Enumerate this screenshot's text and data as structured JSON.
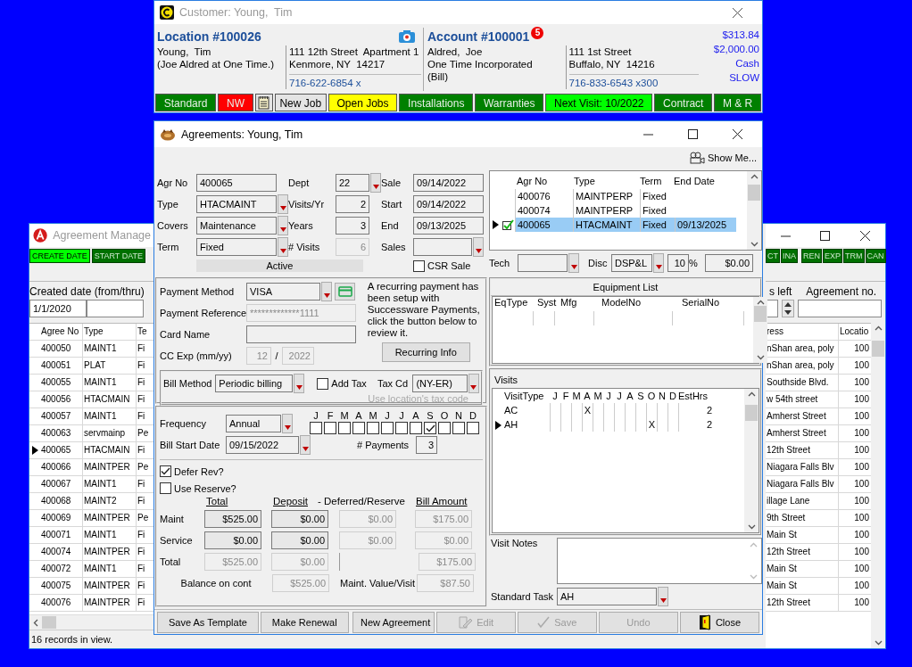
{
  "customer": {
    "title": "Customer: Young,  Tim",
    "location": {
      "heading": "Location #100026",
      "lines": [
        "Young,  Tim",
        "(Joe Aldred at One Time.)"
      ],
      "address": [
        "111 12th Street  Apartment 1",
        "Kenmore, NY  14217"
      ],
      "phone": "716-622-6854 x"
    },
    "account": {
      "heading": "Account #100001",
      "badge": "5",
      "lines": [
        "Aldred,  Joe",
        "One Time Incorporated",
        "(Bill)"
      ],
      "address": [
        "111 1st Street",
        "Buffalo, NY  14216"
      ],
      "phone": "716-833-6543 x300"
    },
    "balances": [
      "$313.84",
      "$2,000.00",
      "Cash",
      "SLOW"
    ],
    "tabs": [
      {
        "label": "Standard",
        "kind": "status",
        "color": "#008000"
      },
      {
        "label": "NW",
        "kind": "status",
        "color": "#ff0000"
      },
      {
        "label": "New Job",
        "kind": "button"
      },
      {
        "label": "Open Jobs",
        "kind": "status",
        "color": "#ffff00"
      },
      {
        "label": "Installations",
        "kind": "status",
        "color": "#008000"
      },
      {
        "label": "Warranties",
        "kind": "status",
        "color": "#008000"
      },
      {
        "label": "Next Visit: 10/2022",
        "kind": "status",
        "color": "#00ff00"
      },
      {
        "label": "Contract",
        "kind": "status",
        "color": "#008000"
      },
      {
        "label": "M & R",
        "kind": "status",
        "color": "#008000"
      }
    ]
  },
  "manager": {
    "title": "Agreement Manage",
    "filters_left": [
      {
        "label": "CREATE DATE",
        "selected": true
      },
      {
        "label": "START DATE",
        "selected": false
      }
    ],
    "filters_right": [
      {
        "label": "CT",
        "selected": false
      },
      {
        "label": "INA",
        "selected": false
      },
      {
        "label": "REN",
        "selected": false
      },
      {
        "label": "EXP",
        "selected": false
      },
      {
        "label": "TRM",
        "selected": false
      },
      {
        "label": "CAN",
        "selected": false
      }
    ],
    "date_label": "Created date (from/thru)",
    "date_from": "1/1/2020",
    "left_label": "s left",
    "agreement_no_label": "Agreement no.",
    "columns_left": [
      "Agree No",
      "Type",
      "Te"
    ],
    "columns_right": [
      "ress",
      "Locatio"
    ],
    "rows": [
      {
        "agree_no": "400050",
        "type": "MAINT1",
        "term": "Fi",
        "address": "nShan area, poly",
        "location": "100",
        "selected": false
      },
      {
        "agree_no": "400051",
        "type": "PLAT",
        "term": "Fi",
        "address": "nShan area, poly",
        "location": "100",
        "selected": false
      },
      {
        "agree_no": "400055",
        "type": "MAINT1",
        "term": "Fi",
        "address": "Southside Blvd.",
        "location": "100",
        "selected": false
      },
      {
        "agree_no": "400056",
        "type": "HTACMAIN",
        "term": "Fi",
        "address": "w 54th street",
        "location": "100",
        "selected": false
      },
      {
        "agree_no": "400057",
        "type": "MAINT1",
        "term": "Fi",
        "address": "Amherst Street",
        "location": "100",
        "selected": false
      },
      {
        "agree_no": "400063",
        "type": "servmainp",
        "term": "Pe",
        "address": "Amherst Street",
        "location": "100",
        "selected": false
      },
      {
        "agree_no": "400065",
        "type": "HTACMAIN",
        "term": "Fi",
        "address": "12th Street",
        "location": "100",
        "selected": true
      },
      {
        "agree_no": "400066",
        "type": "MAINTPER",
        "term": "Pe",
        "address": "Niagara Falls Blv",
        "location": "100",
        "selected": false
      },
      {
        "agree_no": "400067",
        "type": "MAINT1",
        "term": "Fi",
        "address": "Niagara Falls Blv",
        "location": "100",
        "selected": false
      },
      {
        "agree_no": "400068",
        "type": "MAINT2",
        "term": "Fi",
        "address": "illage Lane",
        "location": "100",
        "selected": false
      },
      {
        "agree_no": "400069",
        "type": "MAINTPER",
        "term": "Pe",
        "address": "9th Street",
        "location": "100",
        "selected": false
      },
      {
        "agree_no": "400071",
        "type": "MAINT1",
        "term": "Fi",
        "address": "Main St",
        "location": "100",
        "selected": false
      },
      {
        "agree_no": "400074",
        "type": "MAINTPER",
        "term": "Fi",
        "address": "12th Street",
        "location": "100",
        "selected": false
      },
      {
        "agree_no": "400072",
        "type": "MAINT1",
        "term": "Fi",
        "address": "Main St",
        "location": "100",
        "selected": false
      },
      {
        "agree_no": "400075",
        "type": "MAINTPER",
        "term": "Fi",
        "address": "Main St",
        "location": "100",
        "selected": false
      },
      {
        "agree_no": "400076",
        "type": "MAINTPER",
        "term": "Fi",
        "address": "12th Street",
        "location": "100",
        "selected": false
      }
    ],
    "status": "16 records in view."
  },
  "agreements": {
    "title": "Agreements: Young, Tim",
    "show_me": "Show Me...",
    "header_rows": [
      [
        {
          "label": "Agr No",
          "value": "400065",
          "kind": "text",
          "disabled": false
        },
        {
          "label": "Dept",
          "value": "22",
          "kind": "dropdown",
          "disabled": false
        },
        {
          "label": "Sale",
          "value": "09/14/2022",
          "kind": "text",
          "disabled": false
        }
      ],
      [
        {
          "label": "Type",
          "value": "HTACMAINT",
          "kind": "dropdown",
          "disabled": false
        },
        {
          "label": "Visits/Yr",
          "value": "2",
          "kind": "number",
          "disabled": false
        },
        {
          "label": "Start",
          "value": "09/14/2022",
          "kind": "text",
          "disabled": false
        }
      ],
      [
        {
          "label": "Covers",
          "value": "Maintenance",
          "kind": "dropdown",
          "disabled": false
        },
        {
          "label": "Years",
          "value": "3",
          "kind": "number",
          "disabled": false
        },
        {
          "label": "End",
          "value": "09/13/2025",
          "kind": "text",
          "disabled": false
        }
      ],
      [
        {
          "label": "Term",
          "value": "Fixed",
          "kind": "dropdown",
          "disabled": false
        },
        {
          "label": "# Visits",
          "value": "6",
          "kind": "number",
          "disabled": true
        },
        {
          "label": "Sales",
          "kind": "dropdown",
          "disabled": false
        }
      ]
    ],
    "status_text": "Active",
    "csr_sale": {
      "label": "CSR Sale",
      "checked": false
    },
    "payment": {
      "method_label": "Payment Method",
      "method": "VISA",
      "reference_label": "Payment Reference",
      "reference": "*************1111",
      "card_name_label": "Card Name",
      "exp_label": "CC Exp (mm/yy)",
      "exp_month": "12",
      "exp_sep": "/",
      "exp_year": "2022",
      "note": "A recurring payment has been setup with Successware Payments, click the button below to review it.",
      "recurring_button": "Recurring Info"
    },
    "billing": {
      "method_label": "Bill Method",
      "method": "Periodic billing",
      "add_tax": {
        "label": "Add Tax",
        "checked": false
      },
      "tax_label": "Tax Cd",
      "tax_code": "(NY-ER)",
      "tax_hint": "Use location's tax code"
    },
    "schedule": {
      "frequency_label": "Frequency",
      "frequency": "Annual",
      "bill_start_label": "Bill Start Date",
      "bill_start": "09/15/2022",
      "payments_label": "# Payments",
      "payments": "3",
      "months": [
        {
          "label": "J",
          "checked": false
        },
        {
          "label": "F",
          "checked": false
        },
        {
          "label": "M",
          "checked": false
        },
        {
          "label": "A",
          "checked": false
        },
        {
          "label": "M",
          "checked": false
        },
        {
          "label": "J",
          "checked": false
        },
        {
          "label": "J",
          "checked": false
        },
        {
          "label": "A",
          "checked": false
        },
        {
          "label": "S",
          "checked": true
        },
        {
          "label": "O",
          "checked": false
        },
        {
          "label": "N",
          "checked": false
        },
        {
          "label": "D",
          "checked": false
        }
      ]
    },
    "options": [
      {
        "label": "Defer Rev?",
        "checked": true
      },
      {
        "label": "Use Reserve?",
        "checked": false
      }
    ],
    "amounts": {
      "columns": [
        "Total",
        "Deposit",
        "- Deferred/Reserve",
        "Bill Amount"
      ],
      "rows": [
        {
          "label": "Maint",
          "cells": [
            {
              "kind": "field",
              "value": "$525.00",
              "disabled": false
            },
            {
              "kind": "field",
              "value": "$0.00",
              "disabled": false
            },
            {
              "kind": "field",
              "value": "$0.00",
              "disabled": true
            },
            {
              "kind": "field",
              "value": "$175.00",
              "disabled": true
            }
          ]
        },
        {
          "label": "Service",
          "cells": [
            {
              "kind": "field",
              "value": "$0.00",
              "disabled": false
            },
            {
              "kind": "field",
              "value": "$0.00",
              "disabled": false
            },
            {
              "kind": "field",
              "value": "$0.00",
              "disabled": true
            },
            {
              "kind": "field",
              "value": "$0.00",
              "disabled": true
            }
          ]
        },
        {
          "label": "Total",
          "cells": [
            {
              "kind": "field",
              "value": "$525.00",
              "disabled": true
            },
            {
              "kind": "field",
              "value": "$0.00",
              "disabled": true
            },
            {
              "kind": "blank"
            },
            {
              "kind": "field",
              "value": "$175.00",
              "disabled": true
            }
          ]
        }
      ],
      "balance_label": "Balance on cont",
      "balance": "$525.00",
      "value_label": "Maint. Value/Visit",
      "value": "$87.50"
    },
    "agreement_list": {
      "columns": [
        "Agr No",
        "Type",
        "Term",
        "End Date"
      ],
      "rows": [
        {
          "agr_no": "400076",
          "type": "MAINTPERP",
          "term": "Fixed",
          "checked": false,
          "selected": false
        },
        {
          "agr_no": "400074",
          "type": "MAINTPERP",
          "term": "Fixed",
          "checked": false,
          "selected": false
        },
        {
          "agr_no": "400065",
          "type": "HTACMAINT",
          "term": "Fixed",
          "end_date": "09/13/2025",
          "checked": true,
          "selected": true
        }
      ]
    },
    "tech_label": "Tech",
    "disc": {
      "label": "Disc",
      "code": "DSP&L",
      "percent": "10",
      "percent_sign": "%",
      "amount": "$0.00"
    },
    "equipment": {
      "title": "Equipment List",
      "columns": [
        "EqType",
        "Syst",
        "Mfg",
        "ModelNo",
        "SerialNo"
      ]
    },
    "visits": {
      "title": "Visits",
      "type_heading": "VisitType",
      "months": [
        "J",
        "F",
        "M",
        "A",
        "M",
        "J",
        "J",
        "A",
        "S",
        "O",
        "N",
        "D"
      ],
      "hours_heading": "EstHrs",
      "rows": [
        {
          "type": "AC",
          "mark": "X",
          "months": [
            false,
            false,
            false,
            true,
            false,
            false,
            false,
            false,
            false,
            false,
            false,
            false
          ],
          "est_hrs": "2",
          "selected": false
        },
        {
          "type": "AH",
          "mark": "X",
          "months": [
            false,
            false,
            false,
            false,
            false,
            false,
            false,
            false,
            false,
            true,
            false,
            false
          ],
          "est_hrs": "2",
          "selected": true
        }
      ]
    },
    "visit_notes_label": "Visit Notes",
    "standard_task": {
      "label": "Standard Task",
      "value": "AH"
    },
    "buttons_left": [
      {
        "label": "Save As Template",
        "disabled": false
      },
      {
        "label": "Make Renewal",
        "disabled": false
      }
    ],
    "buttons_right": [
      {
        "label": "New Agreement",
        "kind": "new",
        "disabled": false
      },
      {
        "label": "Edit",
        "kind": "edit",
        "disabled": true
      },
      {
        "label": "Save",
        "kind": "save",
        "disabled": true
      },
      {
        "label": "Undo",
        "kind": "undo",
        "disabled": true
      },
      {
        "label": "Close",
        "kind": "close",
        "disabled": false
      }
    ]
  }
}
